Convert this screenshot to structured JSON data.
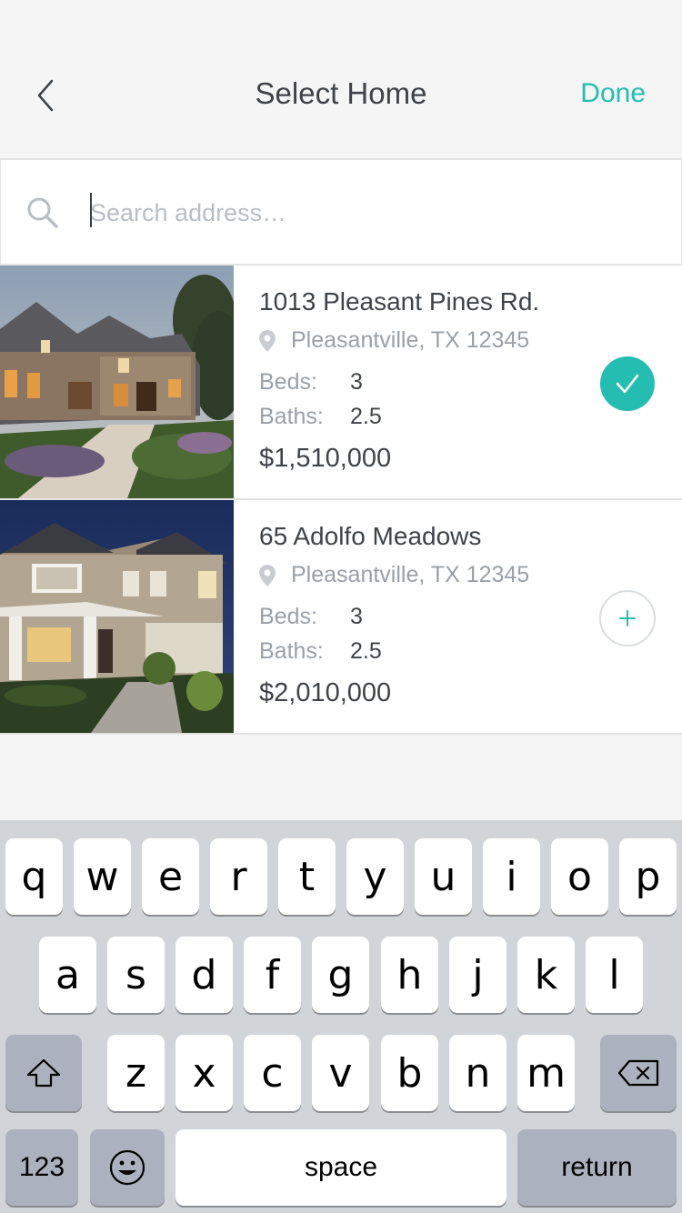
{
  "header": {
    "title": "Select Home",
    "done_label": "Done",
    "back_icon": "chevron-left-icon"
  },
  "search": {
    "placeholder": "Search address…",
    "value": "",
    "icon": "search-icon"
  },
  "listings": [
    {
      "address": "1013 Pleasant Pines Rd.",
      "city": "Pleasantville, TX 12345",
      "beds_label": "Beds:",
      "beds": "3",
      "baths_label": "Baths:",
      "baths": "2.5",
      "price": "$1,510,000",
      "selected": true,
      "action_icon": "check-icon"
    },
    {
      "address": "65 Adolfo Meadows",
      "city": "Pleasantville, TX 12345",
      "beds_label": "Beds:",
      "beds": "3",
      "baths_label": "Baths:",
      "baths": "2.5",
      "price": "$2,010,000",
      "selected": false,
      "action_icon": "plus-icon"
    }
  ],
  "keyboard": {
    "row1": [
      "q",
      "w",
      "e",
      "r",
      "t",
      "y",
      "u",
      "i",
      "o",
      "p"
    ],
    "row2": [
      "a",
      "s",
      "d",
      "f",
      "g",
      "h",
      "j",
      "k",
      "l"
    ],
    "row3": [
      "z",
      "x",
      "c",
      "v",
      "b",
      "n",
      "m"
    ],
    "shift_icon": "shift-icon",
    "delete_icon": "backspace-icon",
    "numbers_label": "123",
    "emoji_icon": "emoji-icon",
    "space_label": "space",
    "return_label": "return"
  },
  "colors": {
    "accent": "#25bdb2",
    "text_primary": "#3f4348",
    "text_secondary": "#9aa0a6"
  }
}
